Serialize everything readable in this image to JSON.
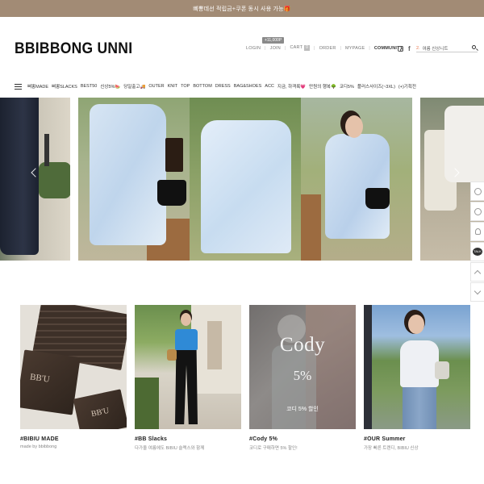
{
  "banner": {
    "text": "삐뽕데선 적립금+쿠폰 동시 사용 가능🎁"
  },
  "logo": {
    "text": "BBIBBONG UNNI"
  },
  "utility": {
    "point_bubble": "+11,000P",
    "items": [
      "LOGIN",
      "JOIN",
      "CART",
      "ORDER",
      "MYPAGE",
      "COMMUNITY"
    ],
    "cart_count": "0"
  },
  "social": {
    "icons": [
      "instagram-icon",
      "facebook-icon"
    ]
  },
  "search": {
    "rank": "2.",
    "keyword": "여름 신상니트"
  },
  "nav": {
    "items": [
      "삐뽕MADE",
      "삐뽕SLACKS",
      "BEST50",
      "신상5%🍉",
      "당일출고🚚",
      "OUTER",
      "KNIT",
      "TOP",
      "BOTTOM",
      "DRESS",
      "BAG&SHOES",
      "ACC",
      "지금, 하객룩💗",
      "만원의 행복🌳",
      "코디5%",
      "플러스사이즈(~3XL)",
      "(+)기획전"
    ]
  },
  "slider": {
    "arrows": [
      "chevron-left-icon",
      "chevron-right-icon"
    ]
  },
  "side_widget": {
    "talk_label": "TALK"
  },
  "cards": [
    {
      "title": "#BIBIU MADE",
      "sub": "made by bbibbong",
      "img_text": [
        "BB'U",
        "BB'U"
      ]
    },
    {
      "title": "#BB Slacks",
      "sub": "다가올 여름에도 BIBIU 슬랙스와 함께"
    },
    {
      "title": "#Cody 5%",
      "sub": "코디로 구매하면 5% 할인!",
      "img_text": [
        "Cody",
        "5%",
        "코디 5% 할인"
      ]
    },
    {
      "title": "#OUR Summer",
      "sub": "가장 빠른 트렌디, BIBIU 신상"
    }
  ]
}
